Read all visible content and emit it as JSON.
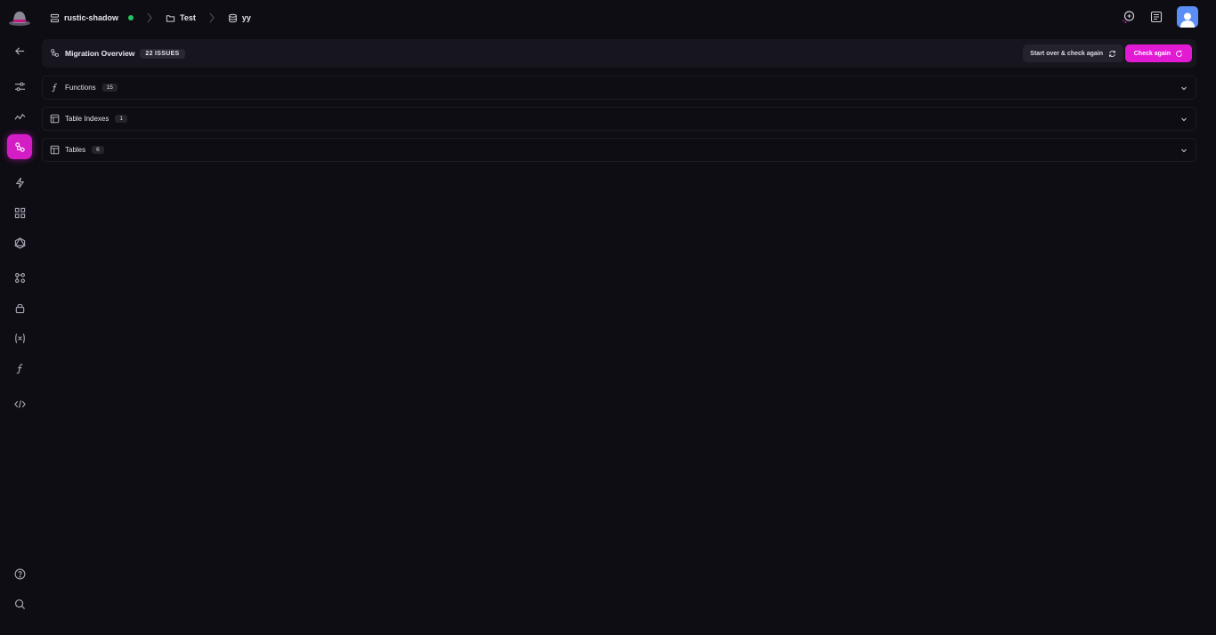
{
  "breadcrumbs": {
    "instance": "rustic-shadow",
    "project": "Test",
    "database": "yy"
  },
  "overview": {
    "title": "Migration Overview",
    "issues_badge": "22 ISSUES",
    "start_over_label": "Start over & check again",
    "check_again_label": "Check again"
  },
  "sections": [
    {
      "label": "Functions",
      "count": "15",
      "icon": "function-icon"
    },
    {
      "label": "Table Indexes",
      "count": "1",
      "icon": "index-icon"
    },
    {
      "label": "Tables",
      "count": "6",
      "icon": "table-icon"
    }
  ],
  "colors": {
    "accent": "#e21ad4",
    "background": "#0e0d13",
    "status_online": "#22c55e"
  },
  "sidebar_icons": [
    "back-arrow-icon",
    "sliders-icon",
    "activity-icon",
    "migration-icon",
    "bolt-icon",
    "grid-icon",
    "graphql-icon",
    "git-icon",
    "lock-icon",
    "variables-icon",
    "function-icon",
    "code-icon",
    "help-icon",
    "search-icon"
  ]
}
